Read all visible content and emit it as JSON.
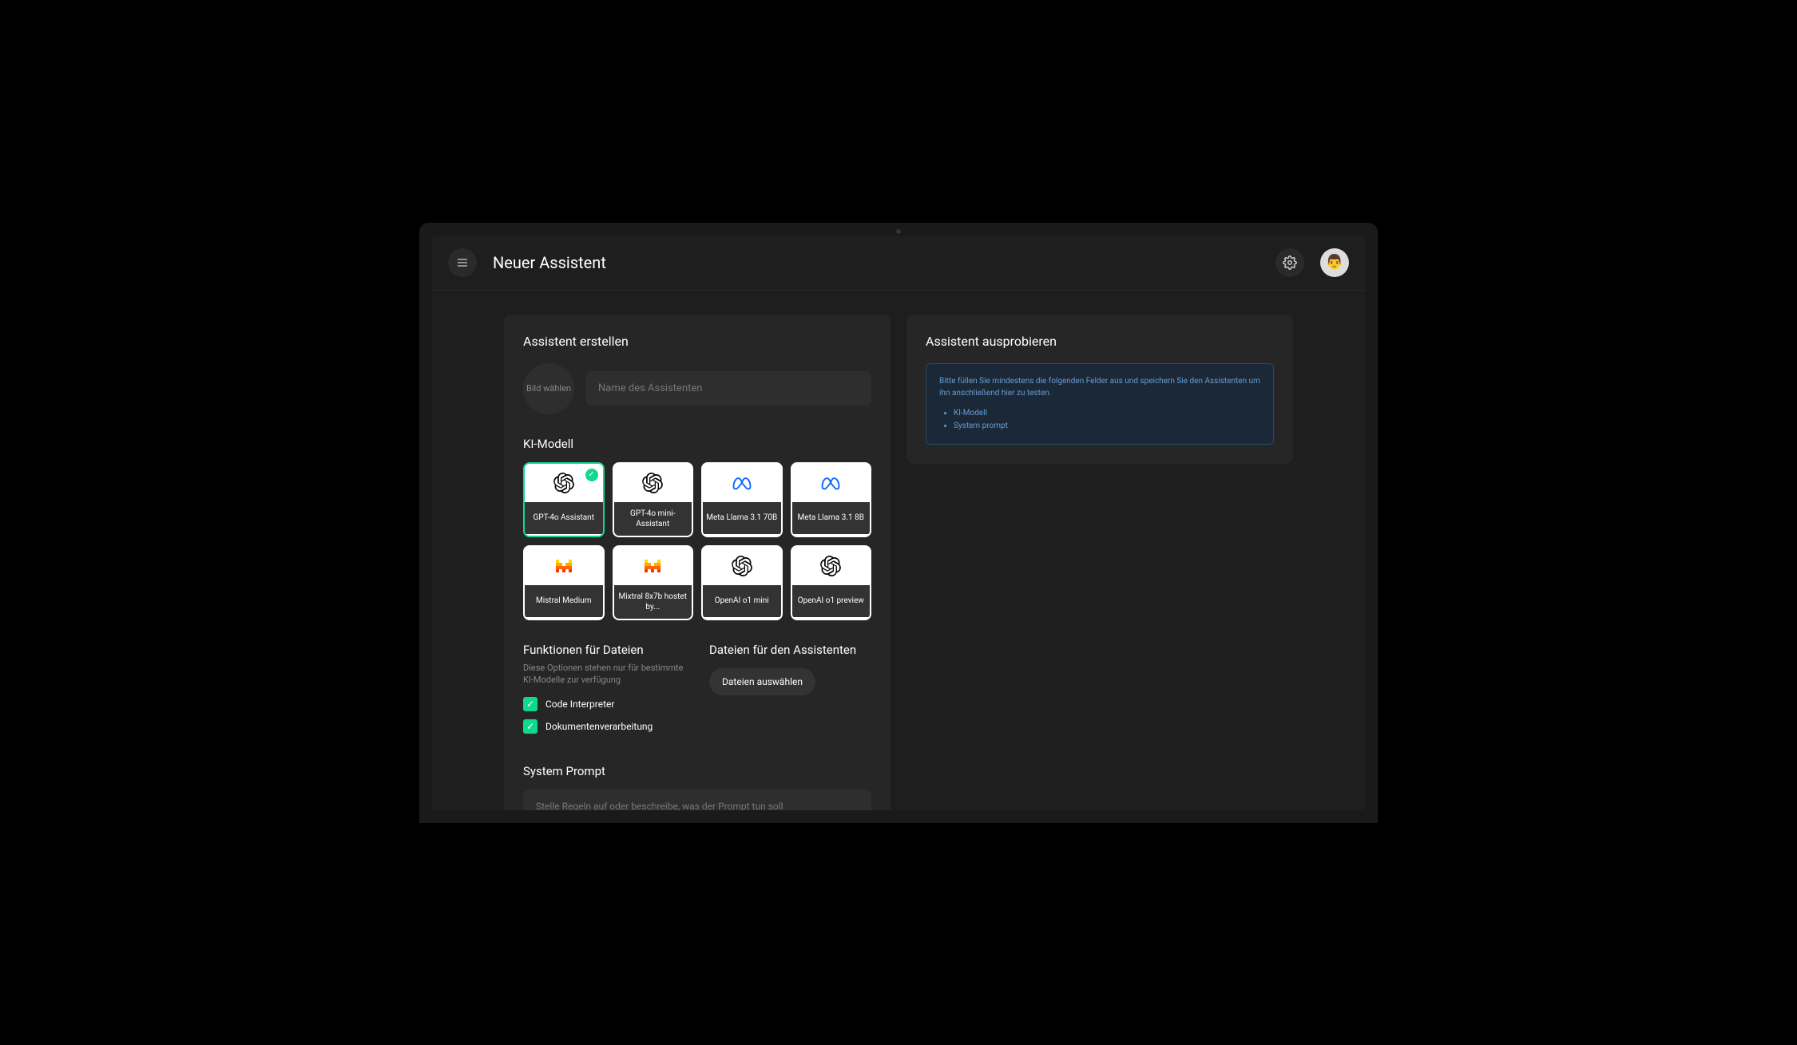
{
  "header": {
    "title": "Neuer Assistent"
  },
  "create": {
    "title": "Assistent erstellen",
    "imageLabel": "Bild wählen",
    "namePlaceholder": "Name des Assistenten"
  },
  "model": {
    "title": "KI-Modell",
    "items": [
      {
        "label": "GPT-4o Assistant",
        "icon": "openai",
        "selected": true
      },
      {
        "label": "GPT-4o mini-Assistant",
        "icon": "openai",
        "selected": false
      },
      {
        "label": "Meta Llama 3.1 70B",
        "icon": "meta",
        "selected": false
      },
      {
        "label": "Meta Llama 3.1 8B",
        "icon": "meta",
        "selected": false
      },
      {
        "label": "Mistral Medium",
        "icon": "mistral",
        "selected": false
      },
      {
        "label": "Mixtral 8x7b hostet by...",
        "icon": "mistral",
        "selected": false
      },
      {
        "label": "OpenAI o1 mini",
        "icon": "openai",
        "selected": false
      },
      {
        "label": "OpenAI o1 preview",
        "icon": "openai",
        "selected": false
      }
    ]
  },
  "functions": {
    "title": "Funktionen für Dateien",
    "help": "Diese Optionen stehen nur für bestimmte KI-Modelle zur verfügung",
    "items": [
      {
        "label": "Code Interpreter",
        "checked": true
      },
      {
        "label": "Dokumentenverarbeitung",
        "checked": true
      }
    ]
  },
  "files": {
    "title": "Dateien für den Assistenten",
    "button": "Dateien auswählen"
  },
  "prompt": {
    "title": "System Prompt",
    "placeholder": "Stelle Regeln auf oder beschreibe, was der Prompt tun soll"
  },
  "tryout": {
    "title": "Assistent ausprobieren",
    "infoText": "Bitte füllen Sie mindestens die folgenden Felder aus und speichern Sie den Assistenten um ihn anschließend hier zu testen.",
    "requiredFields": [
      "KI-Modell",
      "System prompt"
    ]
  }
}
